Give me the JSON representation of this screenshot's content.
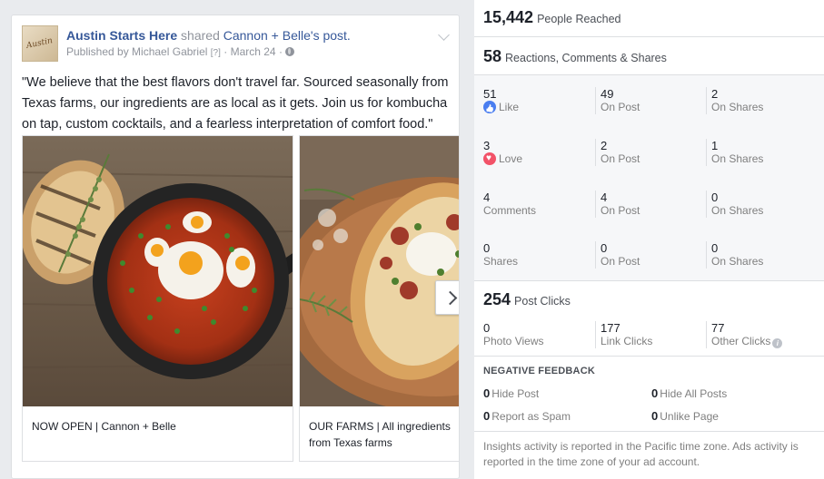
{
  "post": {
    "page_name": "Austin Starts Here",
    "shared_text": "shared",
    "original_page": "Cannon + Belle",
    "original_suffix": "'s post.",
    "published_by": "Published by Michael Gabriel",
    "help_mark": "[?]",
    "date": "March 24",
    "avatar_text": "Austin",
    "body": "\"We believe that the best flavors don't travel far. Sourced seasonally from Texas farms, our ingredients are as local as it gets. Join us for kombucha on tap, custom cocktails, and a fearless interpretation of comfort food.\"",
    "cards": [
      {
        "caption": "NOW OPEN | Cannon + Belle"
      },
      {
        "caption": "OUR FARMS | All ingredients from Texas farms"
      }
    ]
  },
  "insights": {
    "reach": {
      "value": "15,442",
      "label": "People Reached"
    },
    "engagement": {
      "value": "58",
      "label": "Reactions, Comments & Shares"
    },
    "grid": [
      [
        {
          "n": "51",
          "l": "Like",
          "icon": "like-icon"
        },
        {
          "n": "49",
          "l": "On Post"
        },
        {
          "n": "2",
          "l": "On Shares"
        }
      ],
      [
        {
          "n": "3",
          "l": "Love",
          "icon": "love-icon"
        },
        {
          "n": "2",
          "l": "On Post"
        },
        {
          "n": "1",
          "l": "On Shares"
        }
      ],
      [
        {
          "n": "4",
          "l": "Comments"
        },
        {
          "n": "4",
          "l": "On Post"
        },
        {
          "n": "0",
          "l": "On Shares"
        }
      ],
      [
        {
          "n": "0",
          "l": "Shares"
        },
        {
          "n": "0",
          "l": "On Post"
        },
        {
          "n": "0",
          "l": "On Shares"
        }
      ]
    ],
    "clicks": {
      "value": "254",
      "label": "Post Clicks",
      "items": [
        {
          "n": "0",
          "l": "Photo Views"
        },
        {
          "n": "177",
          "l": "Link Clicks"
        },
        {
          "n": "77",
          "l": "Other Clicks"
        }
      ]
    },
    "negative": {
      "title": "NEGATIVE FEEDBACK",
      "items": [
        {
          "n": "0",
          "l": "Hide Post"
        },
        {
          "n": "0",
          "l": "Hide All Posts"
        },
        {
          "n": "0",
          "l": "Report as Spam"
        },
        {
          "n": "0",
          "l": "Unlike Page"
        }
      ]
    },
    "note": "Insights activity is reported in the Pacific time zone. Ads activity is reported in the time zone of your ad account."
  },
  "colors": {
    "link": "#365899",
    "like": "#4a7ef0",
    "love": "#f25268",
    "muted": "#90949c"
  }
}
